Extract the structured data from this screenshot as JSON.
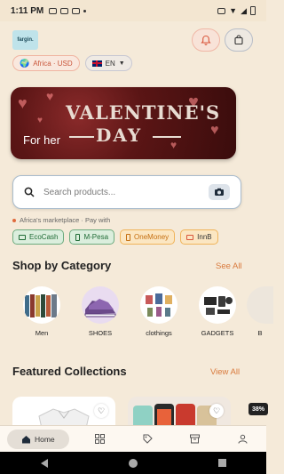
{
  "status_bar": {
    "time": "1:11 PM"
  },
  "header": {
    "logo_text": "fargin."
  },
  "region_pill": {
    "label": "Africa · USD"
  },
  "language_pill": {
    "label": "EN"
  },
  "banner": {
    "line1": "VALENTINE'S",
    "line2": "DAY",
    "tagline": "For her"
  },
  "search": {
    "placeholder": "Search products..."
  },
  "marketplace": {
    "text": "Africa's marketplace · Pay with"
  },
  "payments": [
    "EcoCash",
    "M-Pesa",
    "OneMoney",
    "InnB"
  ],
  "categories_section": {
    "title": "Shop by Category",
    "see_all": "See All"
  },
  "categories": [
    "Men",
    "SHOES",
    "clothings",
    "GADGETS",
    "B"
  ],
  "featured_section": {
    "title": "Featured Collections",
    "view_all": "View All"
  },
  "featured_badge": "38%",
  "bottom_nav": {
    "home": "Home"
  },
  "colors": {
    "accent": "#d97a3d",
    "background": "#f5ead9"
  }
}
